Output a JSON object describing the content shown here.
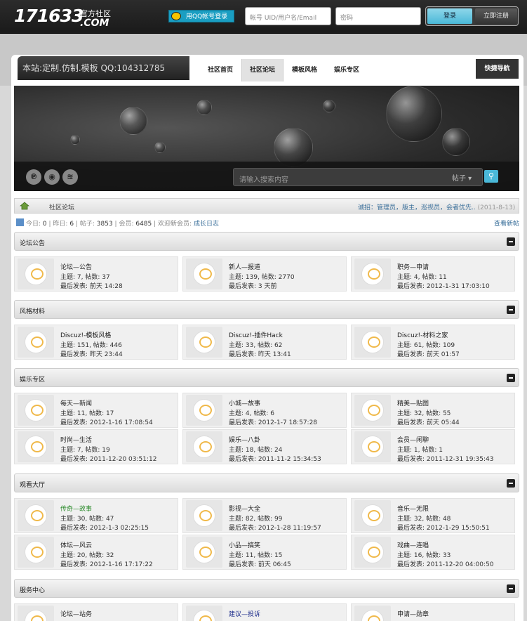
{
  "topbar": {
    "logo_main": "171633",
    "logo_sub": "官方社区",
    "logo_com": ".COM",
    "qq_login": "用QQ帐号登录",
    "user_placeholder": "帐号 UID/用户名/Email",
    "pass_placeholder": "密码",
    "login": "登录",
    "register": "立即注册"
  },
  "header": {
    "slogan": "本站:定制.仿制.模板 QQ:104312785",
    "nav": [
      "社区首页",
      "社区论坛",
      "模板风格",
      "娱乐专区"
    ],
    "active_nav": "社区论坛",
    "quick_nav": "快捷导航"
  },
  "search": {
    "placeholder": "请输入搜索内容",
    "type": "帖子 ▾"
  },
  "breadcrumb": {
    "current": "社区论坛",
    "note": "诚招：管理员，版主，巡视员，会者优先..",
    "note_date": "(2011-8-13)"
  },
  "stats": {
    "today_label": "今日:",
    "today": "0",
    "yesterday_label": "昨日:",
    "yesterday": "6",
    "posts_label": "帖子:",
    "posts": "3853",
    "members_label": "会员:",
    "members": "6485",
    "welcome_label": "欢迎新会员:",
    "new_member": "成长日志",
    "new_posts": "查看新帖"
  },
  "sections": [
    {
      "title": "论坛公告",
      "forums": [
        {
          "name": "论坛—公告",
          "stat": "主题: 7, 帖数: 37",
          "last": "最后发表: 前天 14:28"
        },
        {
          "name": "新人—报道",
          "stat": "主题: 139, 帖数: 2770",
          "last": "最后发表: 3 天前"
        },
        {
          "name": "职务—申请",
          "stat": "主题: 4, 帖数: 11",
          "last": "最后发表: 2012-1-31 17:03:10"
        }
      ]
    },
    {
      "title": "风格材料",
      "forums": [
        {
          "name": "Discuz!-模板风格",
          "stat": "主题: 151, 帖数: 446",
          "last": "最后发表: 昨天 23:44"
        },
        {
          "name": "Discuz!-插件Hack",
          "stat": "主题: 33, 帖数: 62",
          "last": "最后发表: 昨天 13:41"
        },
        {
          "name": "Discuz!-材料之家",
          "stat": "主题: 61, 帖数: 109",
          "last": "最后发表: 前天 01:57"
        }
      ]
    },
    {
      "title": "娱乐专区",
      "forums": [
        {
          "name": "每天—新闻",
          "stat": "主题: 11, 帖数: 17",
          "last": "最后发表: 2012-1-16 17:08:54"
        },
        {
          "name": "小城—故事",
          "stat": "主题: 4, 帖数: 6",
          "last": "最后发表: 2012-1-7 18:57:28"
        },
        {
          "name": "精美—贴图",
          "stat": "主题: 32, 帖数: 55",
          "last": "最后发表: 前天 05:44"
        },
        {
          "name": "时尚—生活",
          "stat": "主题: 7, 帖数: 19",
          "last": "最后发表: 2011-12-20 03:51:12"
        },
        {
          "name": "娱乐—八卦",
          "stat": "主题: 18, 帖数: 24",
          "last": "最后发表: 2011-11-2 15:34:53"
        },
        {
          "name": "会员—闲聊",
          "stat": "主题: 1, 帖数: 1",
          "last": "最后发表: 2011-12-31 19:35:43"
        }
      ]
    },
    {
      "title": "观看大厅",
      "forums": [
        {
          "name": "传奇—故事",
          "stat": "主题: 30, 帖数: 47",
          "last": "最后发表: 2012-1-3 02:25:15",
          "color": "#2a8a2a"
        },
        {
          "name": "影视—大全",
          "stat": "主题: 82, 帖数: 99",
          "last": "最后发表: 2012-1-28 11:19:57"
        },
        {
          "name": "音乐—无限",
          "stat": "主题: 32, 帖数: 48",
          "last": "最后发表: 2012-1-29 15:50:51"
        },
        {
          "name": "体坛—风云",
          "stat": "主题: 20, 帖数: 32",
          "last": "最后发表: 2012-1-16 17:17:22"
        },
        {
          "name": "小品—搞笑",
          "stat": "主题: 11, 帖数: 15",
          "last": "最后发表: 前天 06:45"
        },
        {
          "name": "戏曲—连唱",
          "stat": "主题: 16, 帖数: 33",
          "last": "最后发表: 2011-12-20 04:00:50"
        }
      ]
    },
    {
      "title": "服务中心",
      "forums": [
        {
          "name": "论坛—站务",
          "stat": "",
          "last": ""
        },
        {
          "name": "建议—投诉",
          "stat": "",
          "last": "",
          "color": "#1a2a8a"
        },
        {
          "name": "申请—勋章",
          "stat": "",
          "last": ""
        }
      ]
    }
  ]
}
